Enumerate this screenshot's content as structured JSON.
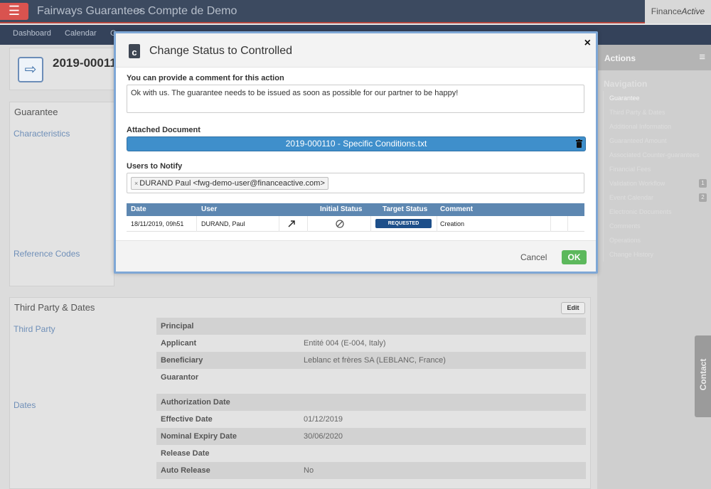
{
  "topbar": {
    "menu_icon": "hamburger-icon",
    "app_name": "Fairways Guarantees",
    "separator": ">",
    "page_name": "Compte de Demo",
    "brand_text": "Finance",
    "brand_italic": "Active"
  },
  "nav": {
    "items": [
      "Dashboard",
      "Calendar",
      "G"
    ]
  },
  "page": {
    "title": "2019-00011",
    "sections": {
      "guarantee": "Guarantee",
      "characteristics": "Characteristics",
      "reference_codes": "Reference Codes",
      "third_party_dates": "Third Party & Dates",
      "edit": "Edit",
      "third_party": "Third Party",
      "dates": "Dates"
    },
    "third_party_rows": [
      {
        "label": "Principal",
        "value": ""
      },
      {
        "label": "Applicant",
        "value": "Entité 004 (E-004, Italy)"
      },
      {
        "label": "Beneficiary",
        "value": "Leblanc et frères SA (LEBLANC, France)"
      },
      {
        "label": "Guarantor",
        "value": ""
      }
    ],
    "date_rows": [
      {
        "label": "Authorization Date",
        "value": ""
      },
      {
        "label": "Effective Date",
        "value": "01/12/2019"
      },
      {
        "label": "Nominal Expiry Date",
        "value": "30/06/2020"
      },
      {
        "label": "Release Date",
        "value": ""
      },
      {
        "label": "Auto Release",
        "value": "No"
      }
    ]
  },
  "sidebar": {
    "actions": "Actions",
    "navigation": "Navigation",
    "items": [
      {
        "label": "Guarantee",
        "count": ""
      },
      {
        "label": "Third Party & Dates",
        "count": ""
      },
      {
        "label": "Additional Information",
        "count": ""
      },
      {
        "label": "Guaranteed Amount",
        "count": ""
      },
      {
        "label": "Associated Counter-guarantees",
        "count": ""
      },
      {
        "label": "Financial Fees",
        "count": ""
      },
      {
        "label": "Validation Workflow",
        "count": "1"
      },
      {
        "label": "Event Calendar",
        "count": "2"
      },
      {
        "label": "Electronic Documents",
        "count": ""
      },
      {
        "label": "Comments",
        "count": ""
      },
      {
        "label": "Operations",
        "count": ""
      },
      {
        "label": "Change History",
        "count": ""
      }
    ],
    "contact": "Contact"
  },
  "modal": {
    "title": "Change Status to Controlled",
    "close": "×",
    "comment_label": "You can provide a comment for this action",
    "comment_value": "Ok with us. The guarantee needs to be issued as soon as possible for our partner to be happy!",
    "attached_label": "Attached Document",
    "attached_file": "2019-000110 - Specific Conditions.txt",
    "users_label": "Users to Notify",
    "user_tag_remove": "×",
    "user_tag": "DURAND Paul <fwg-demo-user@financeactive.com>",
    "history": {
      "headers": [
        "Date",
        "User",
        "Initial Status",
        "Target Status",
        "Comment"
      ],
      "rows": [
        {
          "date": "18/11/2019, 09h51",
          "user": "DURAND, Paul",
          "target_status": "REQUESTED",
          "comment": "Creation"
        }
      ]
    },
    "cancel": "Cancel",
    "ok": "OK"
  },
  "colors": {
    "topbar": "#3c4a60",
    "menu_button": "#d9534f",
    "doc_bar": "#3f8fcb",
    "table_header": "#5d87b1",
    "status_pill": "#1d4f8a",
    "ok_button": "#5cb85c"
  }
}
